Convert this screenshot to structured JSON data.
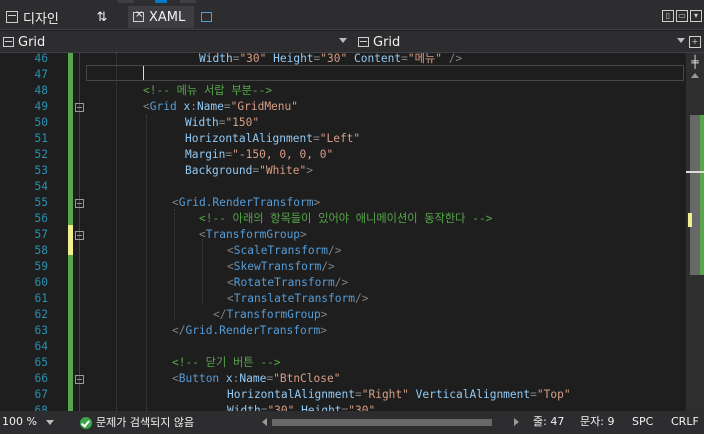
{
  "view_bar": {
    "design_label": "디자인",
    "swap_label": "⇅",
    "xaml_label": "XAML"
  },
  "nav_bar": {
    "left_scope": "Grid",
    "right_scope": "Grid"
  },
  "editor": {
    "lines": [
      {
        "num": "46",
        "parts": [
          {
            "c": "c-attr",
            "t": "Width"
          },
          {
            "c": "c-tag",
            "t": "="
          },
          {
            "c": "c-str",
            "t": "\"30\""
          },
          {
            "c": "c-attr",
            "t": " Height"
          },
          {
            "c": "c-tag",
            "t": "="
          },
          {
            "c": "c-str",
            "t": "\"30\""
          },
          {
            "c": "c-attr",
            "t": " Content"
          },
          {
            "c": "c-tag",
            "t": "="
          },
          {
            "c": "c-str",
            "t": "\"메뉴\""
          },
          {
            "c": "c-tag",
            "t": " />"
          }
        ]
      },
      {
        "num": "47",
        "parts": []
      },
      {
        "num": "48",
        "parts": [
          {
            "c": "c-comment",
            "t": "<!-- 메뉴 서랍 부분-->"
          }
        ]
      },
      {
        "num": "49",
        "parts": [
          {
            "c": "c-tag",
            "t": "<"
          },
          {
            "c": "c-el",
            "t": "Grid"
          },
          {
            "c": "c-attr",
            "t": " x"
          },
          {
            "c": "c-tag",
            "t": ":"
          },
          {
            "c": "c-attr",
            "t": "Name"
          },
          {
            "c": "c-tag",
            "t": "="
          },
          {
            "c": "c-str",
            "t": "\"GridMenu\""
          }
        ]
      },
      {
        "num": "50",
        "parts": [
          {
            "c": "c-attr",
            "t": "Width"
          },
          {
            "c": "c-tag",
            "t": "="
          },
          {
            "c": "c-str",
            "t": "\"150\""
          }
        ]
      },
      {
        "num": "51",
        "parts": [
          {
            "c": "c-attr",
            "t": "HorizontalAlignment"
          },
          {
            "c": "c-tag",
            "t": "="
          },
          {
            "c": "c-str",
            "t": "\"Left\""
          }
        ]
      },
      {
        "num": "52",
        "parts": [
          {
            "c": "c-attr",
            "t": "Margin"
          },
          {
            "c": "c-tag",
            "t": "="
          },
          {
            "c": "c-str",
            "t": "\"-150, 0, 0, 0\""
          }
        ]
      },
      {
        "num": "53",
        "parts": [
          {
            "c": "c-attr",
            "t": "Background"
          },
          {
            "c": "c-tag",
            "t": "="
          },
          {
            "c": "c-str",
            "t": "\"White\""
          },
          {
            "c": "c-tag",
            "t": ">"
          }
        ]
      },
      {
        "num": "54",
        "parts": []
      },
      {
        "num": "55",
        "parts": [
          {
            "c": "c-tag",
            "t": "<"
          },
          {
            "c": "c-el",
            "t": "Grid.RenderTransform"
          },
          {
            "c": "c-tag",
            "t": ">"
          }
        ]
      },
      {
        "num": "56",
        "parts": [
          {
            "c": "c-comment",
            "t": "<!-- 아래의 항목들이 있어야 애니메이션이 동작한다 -->"
          }
        ]
      },
      {
        "num": "57",
        "parts": [
          {
            "c": "c-tag",
            "t": "<"
          },
          {
            "c": "c-el",
            "t": "TransformGroup"
          },
          {
            "c": "c-tag",
            "t": ">"
          }
        ]
      },
      {
        "num": "58",
        "parts": [
          {
            "c": "c-tag",
            "t": "<"
          },
          {
            "c": "c-el",
            "t": "ScaleTransform"
          },
          {
            "c": "c-tag",
            "t": "/>"
          }
        ]
      },
      {
        "num": "59",
        "parts": [
          {
            "c": "c-tag",
            "t": "<"
          },
          {
            "c": "c-el",
            "t": "SkewTransform"
          },
          {
            "c": "c-tag",
            "t": "/>"
          }
        ]
      },
      {
        "num": "60",
        "parts": [
          {
            "c": "c-tag",
            "t": "<"
          },
          {
            "c": "c-el",
            "t": "RotateTransform"
          },
          {
            "c": "c-tag",
            "t": "/>"
          }
        ]
      },
      {
        "num": "61",
        "parts": [
          {
            "c": "c-tag",
            "t": "<"
          },
          {
            "c": "c-el",
            "t": "TranslateTransform"
          },
          {
            "c": "c-tag",
            "t": "/>"
          }
        ]
      },
      {
        "num": "62",
        "parts": [
          {
            "c": "c-tag",
            "t": "</"
          },
          {
            "c": "c-el",
            "t": "TransformGroup"
          },
          {
            "c": "c-tag",
            "t": ">"
          }
        ]
      },
      {
        "num": "63",
        "parts": [
          {
            "c": "c-tag",
            "t": "</"
          },
          {
            "c": "c-el",
            "t": "Grid.RenderTransform"
          },
          {
            "c": "c-tag",
            "t": ">"
          }
        ]
      },
      {
        "num": "64",
        "parts": []
      },
      {
        "num": "65",
        "parts": [
          {
            "c": "c-comment",
            "t": "<!-- 닫기 버튼 -->"
          }
        ]
      },
      {
        "num": "66",
        "parts": [
          {
            "c": "c-tag",
            "t": "<"
          },
          {
            "c": "c-el",
            "t": "Button"
          },
          {
            "c": "c-attr",
            "t": " x"
          },
          {
            "c": "c-tag",
            "t": ":"
          },
          {
            "c": "c-attr",
            "t": "Name"
          },
          {
            "c": "c-tag",
            "t": "="
          },
          {
            "c": "c-str",
            "t": "\"BtnClose\""
          }
        ]
      },
      {
        "num": "67",
        "parts": [
          {
            "c": "c-attr",
            "t": "HorizontalAlignment"
          },
          {
            "c": "c-tag",
            "t": "="
          },
          {
            "c": "c-str",
            "t": "\"Right\""
          },
          {
            "c": "c-attr",
            "t": " VerticalAlignment"
          },
          {
            "c": "c-tag",
            "t": "="
          },
          {
            "c": "c-str",
            "t": "\"Top\""
          }
        ]
      },
      {
        "num": "68",
        "parts": [
          {
            "c": "c-attr",
            "t": "Width"
          },
          {
            "c": "c-tag",
            "t": "="
          },
          {
            "c": "c-str",
            "t": "\"30\""
          },
          {
            "c": "c-attr",
            "t": " Height"
          },
          {
            "c": "c-tag",
            "t": "="
          },
          {
            "c": "c-str",
            "t": "\"30\""
          }
        ]
      }
    ]
  },
  "status_bar": {
    "zoom": "100 %",
    "issues": "문제가 검색되지 않음",
    "line": "줄: 47",
    "char": "문자: 9",
    "spacing": "SPC",
    "line_ending": "CRLF"
  },
  "colors": {
    "background": "#1e1e1e",
    "comment": "#57a64a",
    "element": "#569cd6",
    "attribute": "#92caf4",
    "string": "#d69d85",
    "line_number": "#2b91af",
    "change_saved": "#57a64a",
    "change_unsaved": "#efef91"
  }
}
